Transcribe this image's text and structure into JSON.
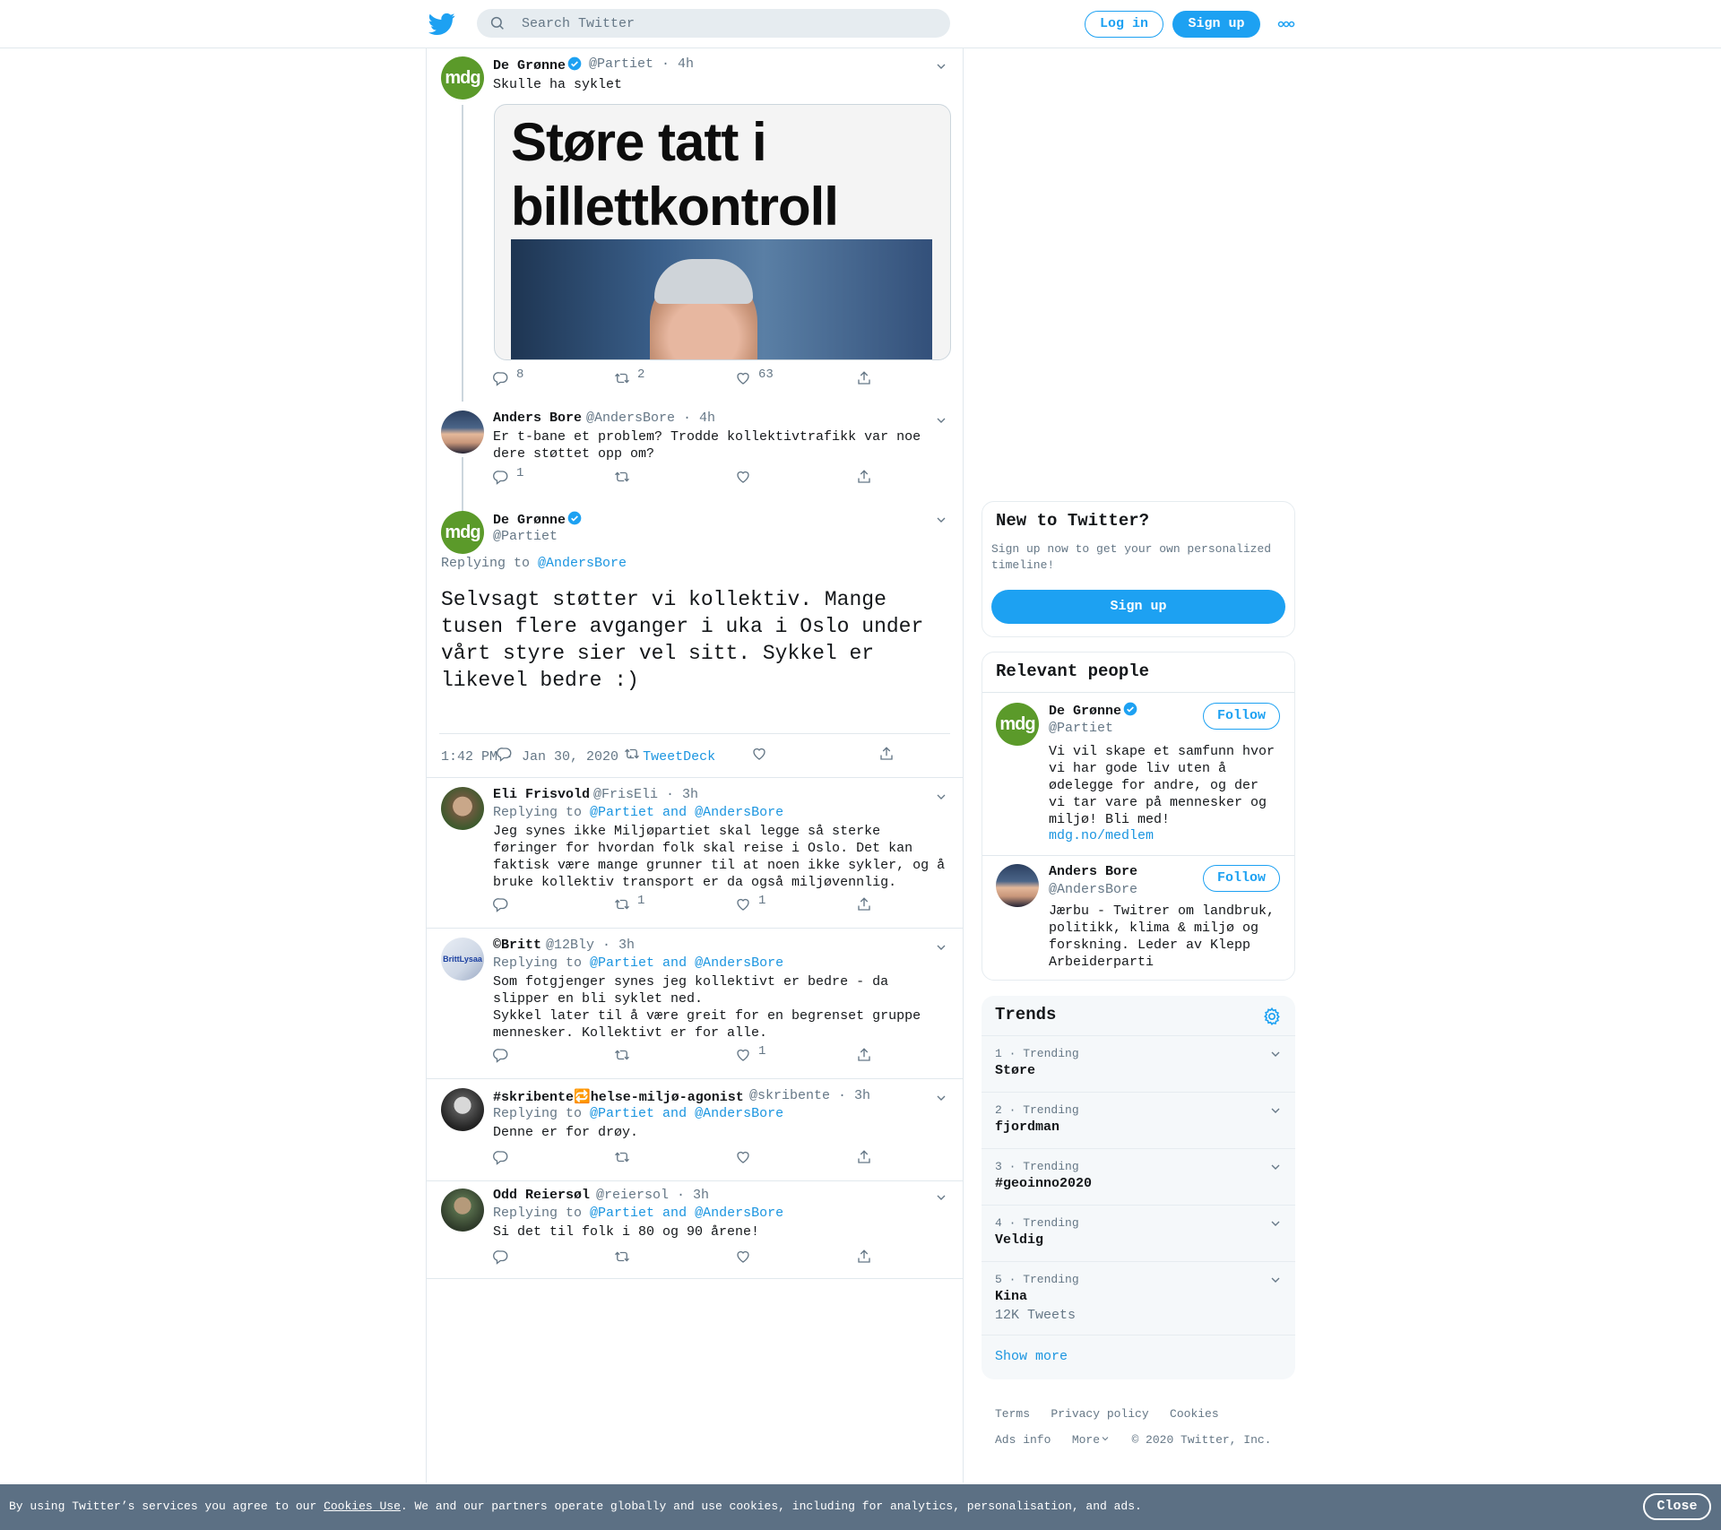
{
  "header": {
    "search_placeholder": "Search Twitter",
    "login_label": "Log in",
    "signup_label": "Sign up"
  },
  "colors": {
    "accent": "#1da1f2",
    "link": "#1b95e0",
    "muted": "#657786",
    "cookie_bar": "#5c7084",
    "mdg_green": "#5b9a2a"
  },
  "tweets": {
    "first": {
      "name": "De Grønne",
      "handle": "@Partiet",
      "time": "· 4h",
      "text": "Skulle ha syklet",
      "media_headline_1": "Støre tatt i",
      "media_headline_2": "billettkontroll",
      "reply_count": "8",
      "retweet_count": "2",
      "like_count": "63"
    },
    "second": {
      "name": "Anders Bore",
      "handle": "@AndersBore",
      "time": "· 4h",
      "text": "Er t-bane et problem? Trodde kollektivtrafikk var noe\ndere støttet opp om?",
      "reply_count": "1"
    },
    "focus": {
      "name": "De Grønne",
      "handle": "@Partiet",
      "replying_prefix": "Replying to",
      "replying_to": "@AndersBore",
      "text": "Selvsagt støtter vi kollektiv. Mange\ntusen flere avganger i uka i Oslo under\nvårt styre sier vel sitt. Sykkel er\nlikevel bedre :)",
      "timestamp": "1:42 PM · Jan 30, 2020 ·",
      "source": "TweetDeck"
    },
    "replies": [
      {
        "name": "Eli Frisvold",
        "handle": "@FrisEli",
        "time": "· 3h",
        "replying_prefix": "Replying to",
        "replying_to": "@Partiet and @AndersBore",
        "text": "Jeg synes ikke Miljøpartiet skal legge så sterke\nføringer for hvordan folk skal reise i Oslo. Det kan\nfaktisk være mange grunner til at noen ikke sykler, og å\nbruke kollektiv transport er da også miljøvennlig.",
        "retweet_count": "1",
        "like_count": "1"
      },
      {
        "name": "©Britt",
        "handle": "@12Bly",
        "time": "· 3h",
        "avatar_text": "BrittLysaa",
        "replying_prefix": "Replying to",
        "replying_to": "@Partiet and @AndersBore",
        "text": "Som fotgjenger synes jeg kollektivt er bedre - da\nslipper en bli syklet ned.\nSykkel later til å være greit for en begrenset gruppe\nmennesker. Kollektivt er for alle.",
        "like_count": "1"
      },
      {
        "name": "#skribente🔁helse-miljø-agonist",
        "handle": "@skribente",
        "time": "· 3h",
        "replying_prefix": "Replying to",
        "replying_to": "@Partiet and @AndersBore",
        "text": "Denne er for drøy."
      },
      {
        "name": "Odd Reiersøl",
        "handle": "@reiersol",
        "time": "· 3h",
        "replying_prefix": "Replying to",
        "replying_to": "@Partiet and @AndersBore",
        "text": "Si det til folk i 80 og 90 årene!"
      }
    ]
  },
  "sidebar": {
    "new_to_twitter": {
      "title": "New to Twitter?",
      "subtitle": "Sign up now to get your own personalized\ntimeline!",
      "signup_label": "Sign up"
    },
    "relevant_people": {
      "title": "Relevant people",
      "people": [
        {
          "name": "De Grønne",
          "handle": "@Partiet",
          "follow_label": "Follow",
          "bio": "Vi vil skape et samfunn hvor\nvi har gode liv uten å\nødelegge for andre, og der\nvi tar vare på mennesker og\nmiljø! Bli med!",
          "link": "mdg.no/medlem"
        },
        {
          "name": "Anders Bore",
          "handle": "@AndersBore",
          "follow_label": "Follow",
          "bio": "Jærbu - Twitrer om landbruk,\npolitikk, klima & miljø og\nforskning. Leder av Klepp\nArbeiderparti"
        }
      ]
    },
    "trends": {
      "title": "Trends",
      "items": [
        {
          "meta": "1 · Trending",
          "name": "Støre"
        },
        {
          "meta": "2 · Trending",
          "name": "fjordman"
        },
        {
          "meta": "3 · Trending",
          "name": "#geoinno2020"
        },
        {
          "meta": "4 · Trending",
          "name": "Veldig"
        },
        {
          "meta": "5 · Trending",
          "name": "Kina",
          "count": "12K Tweets"
        }
      ],
      "show_more": "Show more"
    },
    "footer": {
      "terms": "Terms",
      "privacy": "Privacy policy",
      "cookies": "Cookies",
      "ads_info": "Ads info",
      "more": "More",
      "copyright": "© 2020 Twitter, Inc."
    }
  },
  "cookie_bar": {
    "text_before": "By using Twitter’s services you agree to our ",
    "link": "Cookies Use",
    "text_after": ". We and our partners operate globally and use cookies, including for analytics, personalisation, and ads.",
    "close_label": "Close"
  }
}
